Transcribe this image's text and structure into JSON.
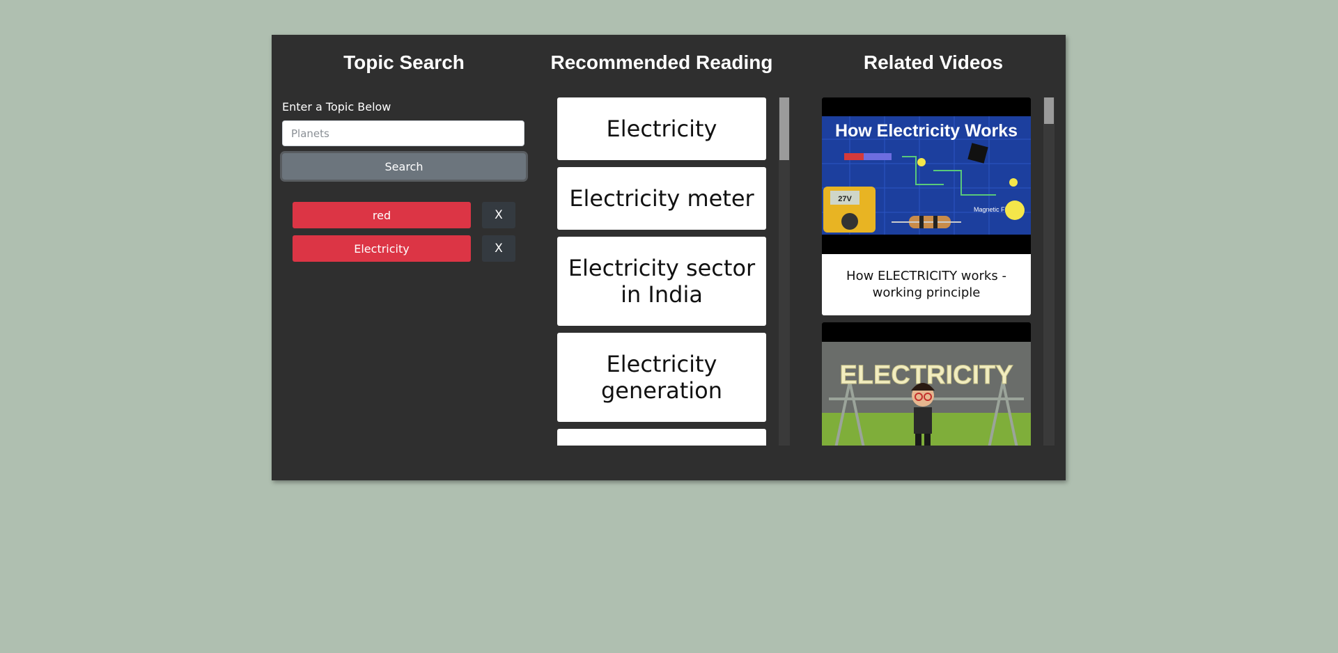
{
  "topic_search": {
    "title": "Topic Search",
    "input_label": "Enter a Topic Below",
    "input_placeholder": "Planets",
    "input_value": "",
    "search_label": "Search",
    "history": [
      {
        "label": "red",
        "remove_label": "X"
      },
      {
        "label": "Electricity",
        "remove_label": "X"
      }
    ]
  },
  "reading": {
    "title": "Recommended Reading",
    "items": [
      {
        "label": "Electricity"
      },
      {
        "label": "Electricity meter"
      },
      {
        "label": "Electricity sector in India"
      },
      {
        "label": "Electricity generation"
      }
    ]
  },
  "videos": {
    "title": "Related Videos",
    "items": [
      {
        "thumbnail_text": "How Electricity Works",
        "title": "How ELECTRICITY works - working principle",
        "thumbnail_extra": [
          "27V",
          "Magnetic Field"
        ]
      },
      {
        "thumbnail_text": "ELECTRICITY",
        "title": ""
      }
    ]
  },
  "colors": {
    "page_bg": "#afbfb0",
    "panel_bg": "#2f2f2f",
    "history_button": "#dc3545",
    "remove_button": "#343a40",
    "search_button": "#6c757d"
  },
  "icons": {
    "remove": "close-icon"
  }
}
